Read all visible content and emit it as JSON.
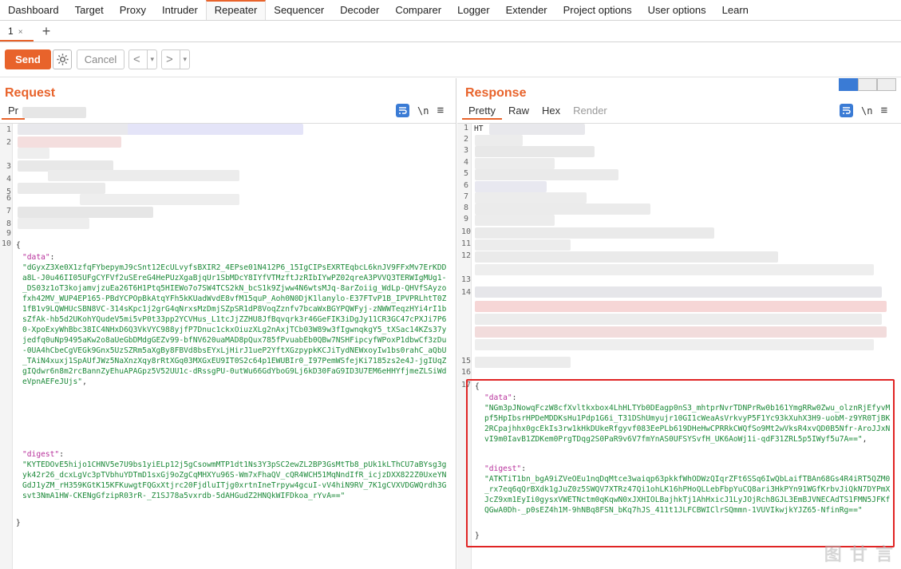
{
  "top_tabs": [
    "Dashboard",
    "Target",
    "Proxy",
    "Intruder",
    "Repeater",
    "Sequencer",
    "Decoder",
    "Comparer",
    "Logger",
    "Extender",
    "Project options",
    "User options",
    "Learn"
  ],
  "sub_tab": {
    "label": "1",
    "close": "×",
    "add": "+"
  },
  "toolbar": {
    "send": "Send",
    "cancel": "Cancel",
    "prev": "<",
    "next": ">",
    "dropdown": "▾"
  },
  "request": {
    "title": "Request",
    "tab_first": "Pr",
    "icon_newline": "\\n",
    "icon_menu": "≡",
    "line_numbers": [
      "1",
      "2",
      "3",
      "4",
      "5",
      "6",
      "7",
      "8",
      "9",
      "10"
    ],
    "brace_open": "{",
    "data_key": "\"data\"",
    "data_colon": ":",
    "data_value": "\"dGyxZ3Xe0X1zfqFYbepymJ9cSnt12EcULvyfsBXIR2_4EPse01N412P6_15IgCIPsEXRTEqbcL6knJV9FFxMv7ErKDDa8L-J0u46II05UFgCYFVf2uSEreG4HePUzXgaBjqUr1SbMDcY8IYfVTMzftJzRIbIYwPZ02qreA3PVVQ3TERWIgMUg1-_DS03z1oT3kojamvjzuEa26T6H1Ptq5HIEWo7o7SW4TCS2kN_bcS1k9Zjww4N6wtsMJq-8arZoiig_WdLp-QHVfSAyzofxh42MV_WUP4EP165-PBdYCPOpBkAtqYFh5kKUadWvdE8vfM15quP_Aoh0N0DjK1lanylo-E37FTvP1B_IPVPRLhtT0Z1fB1v9LQWHUcSBN8VC-314sKpc1j2grG4qNrxsMzDmjSZpSR1dP8VoqZznfv7bcaWxBGYPQWFyj-zNWWTeqzHYi4rI1bsZfAk-hb5d2UKohYQudeV5mi5vP0t33pp2YCVHus_L1tcJjZZHU8JfBqvqrk3r46GeFIK3iDgJy11CR3GC47cPXJi7P60-XpoExyWhBbc38IC4NHxD6Q3VkVYC988yjfP7Dnuc1ckxOiuzXLg2nAxjTCb03W89w3fIgwnqkgY5_tXSac14KZs37yjedfq0uNp9495aKw2o8aUeGbDMdgGEZv99-bfNV620uaMAD8pQux785fPvuabEb0QBw7NSHFipcyfWPoxP1dbwCf3zDu-0UA4hCbeCgVEGk9Gnx5UzSZRm5aXgBy8FBVd8bsEYxLjHirJ1ueP2YftXGzpypkKCJiTydNEWxoyIw1bs0rahC_aQbU_TAiN4xuxj1SpAUfJWz5NaXnzXqy8rRtXGq03MXGxEU9IT0S2c64p1EWUBIr0_I97PemWSfejKi7185zs2e4J-jgIUqZgIQdwr6n8m2rcBannZyEhuAPAGpz5V52UU1c-dRssgPU-0utWu66GdYboG9Lj6kD30FaG9ID3U7EM6eHHYfjmeZLSiWdeVpnAEFeJUjs\"",
    "data_comma": ",",
    "digest_key": "\"digest\"",
    "digest_value": "\"KYTEDOvE5hijo1CHNV5e7U9bs1yiELp12j5gCsowmMTP1dt1Ns3Y3pSC2ewZL2BP3GsMtTb8_pUk1kLThCU7aBYsg3gyk42r26_dcxLgVc3pTVbhuYDTmD1sxGj9oZgCqMHXYu96S-Wm7xFhaQV_cQR4WCH51MqNndIfR_icjzDXX822Z0UxeYNGdJ1yZM_rH359KGtK15KFKuwgtFQGxXtjrc20FjdluITjg0xrtnIneTrpyw4gcuI-vV4hiN9RV_7K1gCVXVDGWQrdh3Gsvt3NmA1HW-CKENgGfzipR03rR-_Z1SJ78a5vxrdb-5dAHGudZ2HNQkWIFDkoa_rYvA==\"",
    "brace_close": "}"
  },
  "response": {
    "title": "Response",
    "tabs": [
      "Pretty",
      "Raw",
      "Hex",
      "Render"
    ],
    "active_tab": "Pretty",
    "icon_newline": "\\n",
    "icon_menu": "≡",
    "line_numbers": [
      "1",
      "2",
      "3",
      "4",
      "5",
      "6",
      "7",
      "8",
      "9",
      "10",
      "11",
      "12",
      "13",
      "14",
      "15",
      "16",
      "17",
      "18"
    ],
    "first_line": "HT",
    "brace_open": "{",
    "data_key": "\"data\"",
    "data_colon": ":",
    "data_value": "\"NGm3pJNowqFczW8cfXvltkxbox4LhHLTYb0DEagp0nS3_mhtprNvrTDNPrRw0b161YmgRRw0Zwu_olznRjEfyvMpf5HpIbsrHPDeMDDKsHu1Pdp1G6i_T31DShUmyujr10GI1cWeaAsVrkvyP5F1Yc93kXuhX3H9-uobM-z9YR0TjBK2RCpajhhx0gcEkIs3rw1kHkDUkeRfgyvf083EePLb619DHeHwCPRRkCWQfSo9Mt2wVksR4xvQD0B5Nfr-AroJJxNvI9m0IavB1ZDKem0PrgTDqg2S0PaR9v6V7fmYnAS0UFSYSvfH_UK6AoWj1i-qdF31ZRL5p5IWyf5u7A==\"",
    "data_comma": ",",
    "digest_key": "\"digest\"",
    "digest_value": "\"ATKTiT1bn_bgA9iZVeOEu1nqDqMtce3waiqp63pkkfWhODWzQIqrZFt6SSq6IwQbLaifTBAn68Gs4R4iRT5QZM0_rx7eq6qQrBXdk1gJuZ0z5SWQV7XTRz47Qi1ohLK16hPHoQLLebFbpYuCQ8ari3HkPYn91WGfKrbvJiQkN7DYPmXJcZ9xm1EyIi0gysxVWETNctm0qKqwN0xJXHIOLBajhkTj1AhHxicJ1LyJOjRch8GJL3EmBJVNECAdTS1FMN5JFKfQGwA0Dh-_p0sEZ4h1M-9hNBq8FSN_bKq7hJS_411t1JLFCBWIClrSQmmn-1VUVIkwjkYJZ65-NfinRg==\"",
    "brace_close": "}"
  },
  "watermark": "图 甘 言"
}
